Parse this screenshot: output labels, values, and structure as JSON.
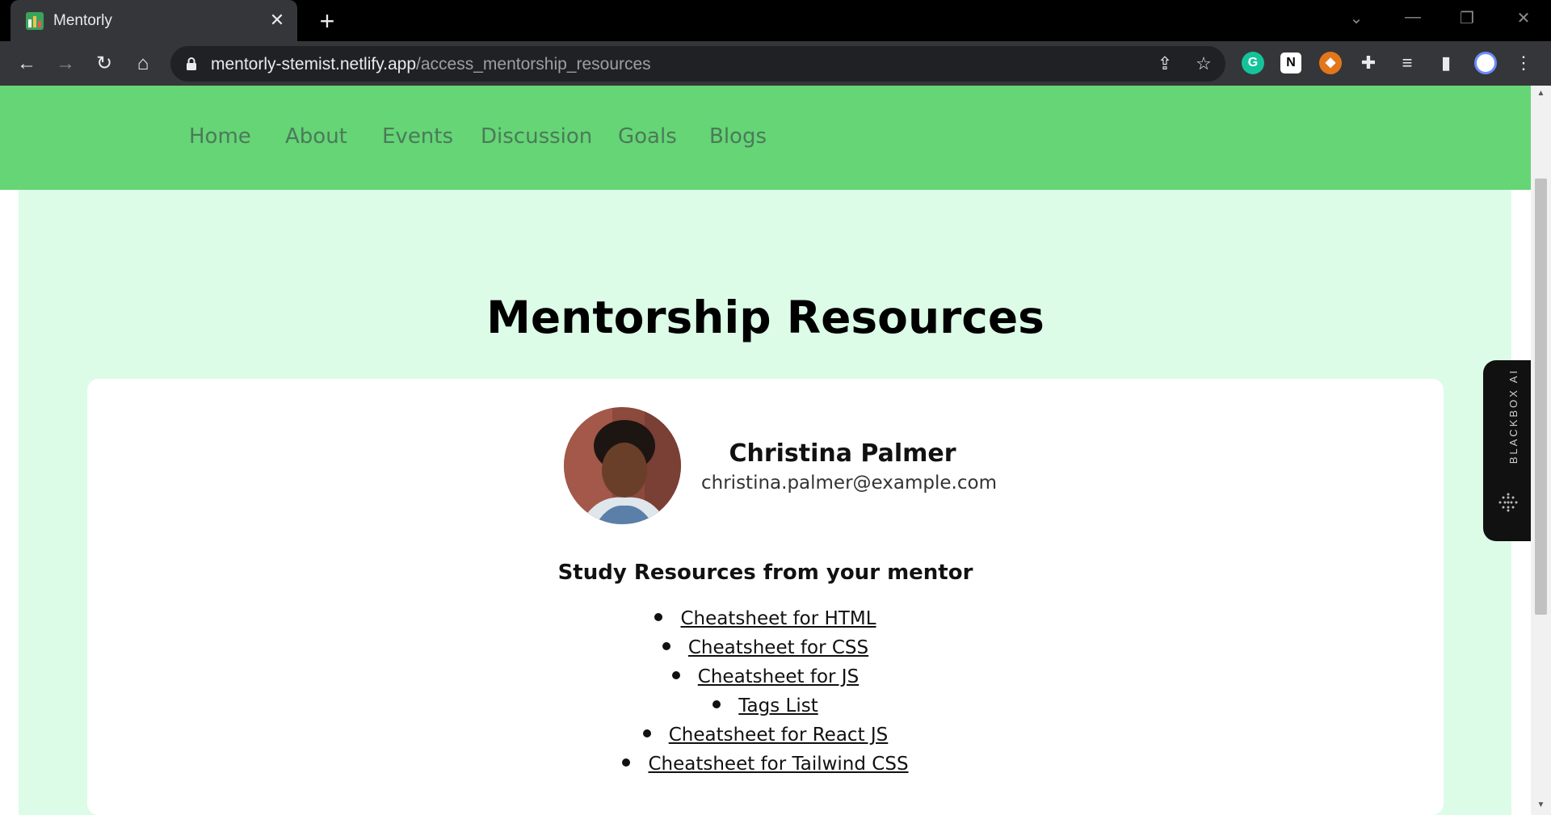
{
  "browser": {
    "tab_title": "Mentorly",
    "tab_close": "✕",
    "new_tab": "+",
    "url_host": "mentorly-stemist.netlify.app",
    "url_path": "/access_mentorship_resources"
  },
  "nav": {
    "items": [
      "Home",
      "About",
      "Events",
      "Discussion",
      "Goals",
      "Blogs"
    ]
  },
  "main": {
    "title": "Mentorship Resources",
    "mentor_name": "Christina Palmer",
    "mentor_email": "christina.palmer@example.com",
    "resources_heading": "Study Resources from your mentor",
    "resources": [
      "Cheatsheet for HTML",
      "Cheatsheet for CSS",
      "Cheatsheet for JS",
      "Tags List",
      "Cheatsheet for React JS",
      "Cheatsheet for Tailwind CSS"
    ]
  },
  "side_widget": {
    "label": "BLACKBOX AI"
  },
  "colors": {
    "navbar": "#65d575",
    "page_bg": "#dcfce7",
    "card_bg": "#ffffff"
  }
}
